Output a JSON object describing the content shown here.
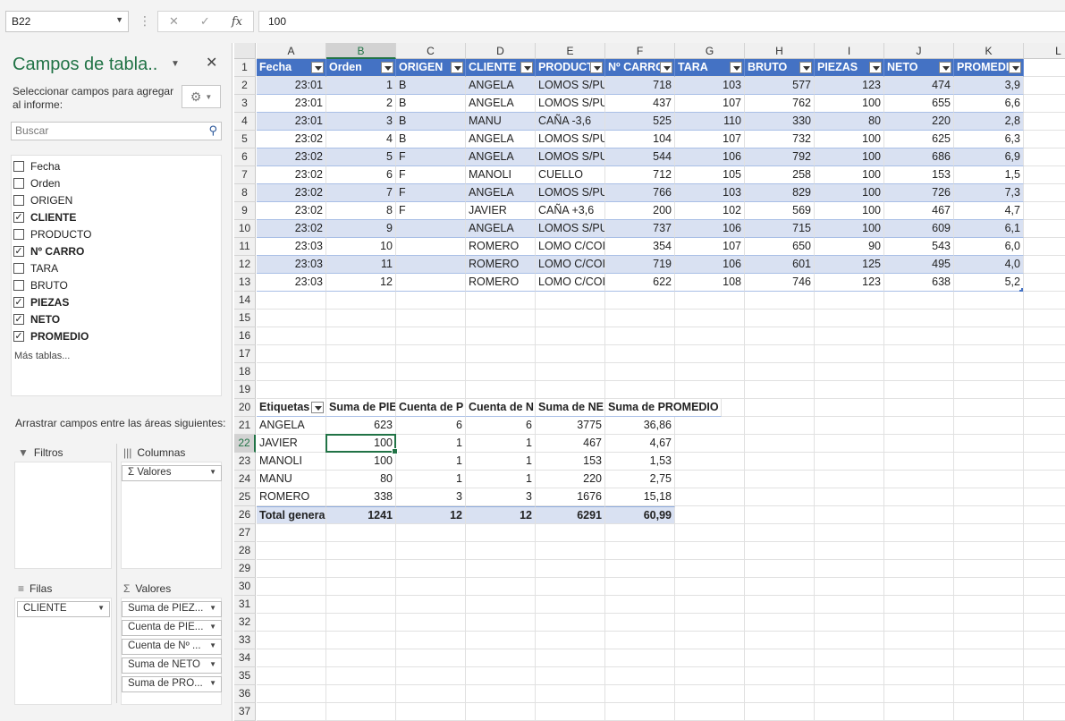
{
  "formula_bar": {
    "name_box": "B22",
    "content": "100"
  },
  "panel": {
    "title": "Campos de tabla..",
    "subtitle": "Seleccionar campos para agregar al informe:",
    "search_placeholder": "Buscar",
    "fields": [
      {
        "label": "Fecha",
        "checked": false
      },
      {
        "label": "Orden",
        "checked": false
      },
      {
        "label": "ORIGEN",
        "checked": false
      },
      {
        "label": "CLIENTE",
        "checked": true
      },
      {
        "label": "PRODUCTO",
        "checked": false
      },
      {
        "label": "Nº CARRO",
        "checked": true
      },
      {
        "label": "TARA",
        "checked": false
      },
      {
        "label": "BRUTO",
        "checked": false
      },
      {
        "label": "PIEZAS",
        "checked": true
      },
      {
        "label": "NETO",
        "checked": true
      },
      {
        "label": "PROMEDIO",
        "checked": true
      }
    ],
    "more_tables": "Más tablas...",
    "drag_label": "Arrastrar campos entre las áreas siguientes:",
    "areas": {
      "filters": "Filtros",
      "columns": "Columnas",
      "rows": "Filas",
      "values": "Valores"
    },
    "columns_items": [
      "Valores"
    ],
    "rows_items": [
      "CLIENTE"
    ],
    "values_items": [
      "Suma de PIEZ...",
      "Cuenta de PIE...",
      "Cuenta de Nº ...",
      "Suma de NETO",
      "Suma de PRO..."
    ]
  },
  "sheet": {
    "columns": [
      "A",
      "B",
      "C",
      "D",
      "E",
      "F",
      "G",
      "H",
      "I",
      "J",
      "K",
      "L"
    ],
    "selected_column": "B",
    "selected_row": 22,
    "row_count": 37,
    "table_headers": [
      "Fecha",
      "Orden",
      "ORIGEN",
      "CLIENTE",
      "PRODUCTO",
      "Nº CARRO",
      "TARA",
      "BRUTO",
      "PIEZAS",
      "NETO",
      "PROMEDIO"
    ],
    "table_header_display": [
      "Fecha",
      "Orden",
      "ORIGEN",
      "CLIENTE",
      "PRODUCT",
      "Nº CARRO",
      "TARA",
      "BRUTO",
      "PIEZAS",
      "NETO",
      "PROMEDI"
    ],
    "table_rows": [
      [
        "23:01",
        "1",
        "B",
        "ANGELA",
        "LOMOS S/PU",
        "718",
        "103",
        "577",
        "123",
        "474",
        "3,9"
      ],
      [
        "23:01",
        "2",
        "B",
        "ANGELA",
        "LOMOS S/PU",
        "437",
        "107",
        "762",
        "100",
        "655",
        "6,6"
      ],
      [
        "23:01",
        "3",
        "B",
        "MANU",
        "CAÑA -3,6",
        "525",
        "110",
        "330",
        "80",
        "220",
        "2,8"
      ],
      [
        "23:02",
        "4",
        "B",
        "ANGELA",
        "LOMOS S/PU",
        "104",
        "107",
        "732",
        "100",
        "625",
        "6,3"
      ],
      [
        "23:02",
        "5",
        "F",
        "ANGELA",
        "LOMOS S/PU",
        "544",
        "106",
        "792",
        "100",
        "686",
        "6,9"
      ],
      [
        "23:02",
        "6",
        "F",
        "MANOLI",
        "CUELLO",
        "712",
        "105",
        "258",
        "100",
        "153",
        "1,5"
      ],
      [
        "23:02",
        "7",
        "F",
        "ANGELA",
        "LOMOS S/PU",
        "766",
        "103",
        "829",
        "100",
        "726",
        "7,3"
      ],
      [
        "23:02",
        "8",
        "F",
        "JAVIER",
        "CAÑA +3,6",
        "200",
        "102",
        "569",
        "100",
        "467",
        "4,7"
      ],
      [
        "23:02",
        "9",
        "",
        "ANGELA",
        "LOMOS S/PU",
        "737",
        "106",
        "715",
        "100",
        "609",
        "6,1"
      ],
      [
        "23:03",
        "10",
        "",
        "ROMERO",
        "LOMO C/COI",
        "354",
        "107",
        "650",
        "90",
        "543",
        "6,0"
      ],
      [
        "23:03",
        "11",
        "",
        "ROMERO",
        "LOMO C/COI",
        "719",
        "106",
        "601",
        "125",
        "495",
        "4,0"
      ],
      [
        "23:03",
        "12",
        "",
        "ROMERO",
        "LOMO C/COI",
        "622",
        "108",
        "746",
        "123",
        "638",
        "5,2"
      ]
    ],
    "pivot_headers": [
      "Etiquetas",
      "Suma de PIE",
      "Cuenta de P",
      "Cuenta de N",
      "Suma de NE",
      "Suma de PROMEDIO"
    ],
    "pivot_rows": [
      [
        "ANGELA",
        "623",
        "6",
        "6",
        "3775",
        "36,86"
      ],
      [
        "JAVIER",
        "100",
        "1",
        "1",
        "467",
        "4,67"
      ],
      [
        "MANOLI",
        "100",
        "1",
        "1",
        "153",
        "1,53"
      ],
      [
        "MANU",
        "80",
        "1",
        "1",
        "220",
        "2,75"
      ],
      [
        "ROMERO",
        "338",
        "3",
        "3",
        "1676",
        "15,18"
      ]
    ],
    "pivot_total": [
      "Total genera",
      "1241",
      "12",
      "12",
      "6291",
      "60,99"
    ]
  }
}
